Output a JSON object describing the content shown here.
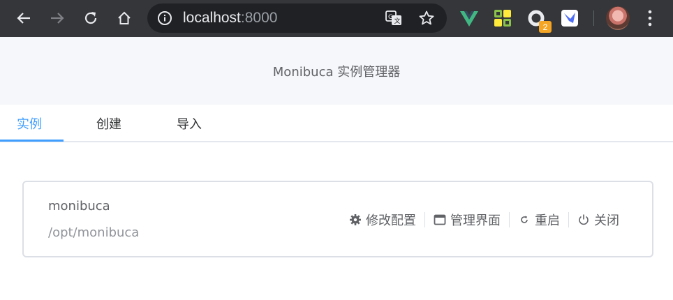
{
  "browser": {
    "url_host": "localhost",
    "url_port": ":8000",
    "extension_badge": "2"
  },
  "app": {
    "title": "Monibuca 实例管理器",
    "tabs": [
      {
        "label": "实例",
        "active": true
      },
      {
        "label": "创建",
        "active": false
      },
      {
        "label": "导入",
        "active": false
      }
    ]
  },
  "instance": {
    "name": "monibuca",
    "path": "/opt/monibuca",
    "actions": [
      {
        "label": "修改配置",
        "icon": "gear-icon"
      },
      {
        "label": "管理界面",
        "icon": "window-icon"
      },
      {
        "label": "重启",
        "icon": "refresh-icon"
      },
      {
        "label": "关闭",
        "icon": "power-icon"
      }
    ]
  },
  "colors": {
    "accent": "#409eff",
    "toolbar": "#35363a",
    "header_bg": "#f5f7fa"
  }
}
